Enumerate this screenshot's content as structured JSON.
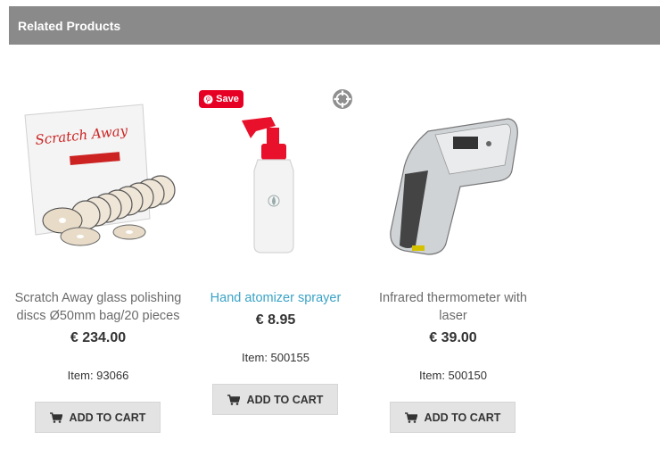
{
  "section": {
    "title": "Related Products"
  },
  "pin": {
    "save_label": "Save"
  },
  "colors": {
    "header_bg": "#8a8a8a",
    "link": "#3aa3c6",
    "pinterest": "#e60023",
    "button_bg": "#e3e3e3"
  },
  "products": [
    {
      "title_line1": "Scratch Away glass polishing",
      "title_line2": "discs Ø50mm bag/20 pieces",
      "price": "€ 234.00",
      "item": "Item: 93066",
      "cart_label": "ADD TO CART",
      "image_icon": "polishing-discs-image"
    },
    {
      "title_line1": "Hand atomizer sprayer",
      "price": "€ 8.95",
      "item": "Item: 500155",
      "cart_label": "ADD TO CART",
      "image_icon": "spray-bottle-image"
    },
    {
      "title_line1": "Infrared thermometer with",
      "title_line2": "laser",
      "price": "€ 39.00",
      "item": "Item: 500150",
      "cart_label": "ADD TO CART",
      "image_icon": "thermometer-image"
    }
  ]
}
